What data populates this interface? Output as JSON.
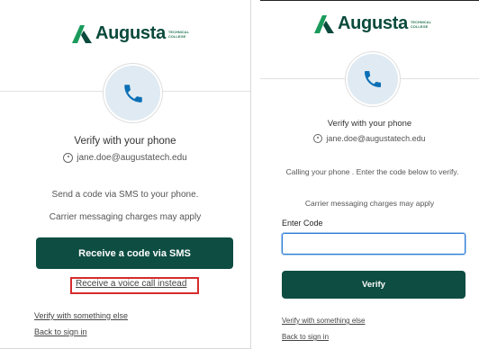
{
  "brand": {
    "name": "Augusta",
    "tag_line1": "TECHNICAL",
    "tag_line2": "COLLEGE",
    "primary_color": "#0e4d42",
    "icon_color": "#0b6fb6"
  },
  "left_screen": {
    "title": "Verify with your phone",
    "account": "jane.doe@augustatech.edu",
    "description": "Send a code via SMS to your phone.",
    "charges_note": "Carrier messaging charges may apply",
    "primary_button": "Receive a code via SMS",
    "voice_link": "Receive a voice call instead",
    "verify_else": "Verify with something else",
    "back_link": "Back to sign in"
  },
  "right_screen": {
    "title": "Verify with your phone",
    "account": "jane.doe@augustatech.edu",
    "status": "Calling your phone . Enter the code below to verify.",
    "charges_note": "Carrier messaging charges may apply",
    "code_label": "Enter Code",
    "code_value": "",
    "primary_button": "Verify",
    "verify_else": "Verify with something else",
    "back_link": "Back to sign in"
  }
}
